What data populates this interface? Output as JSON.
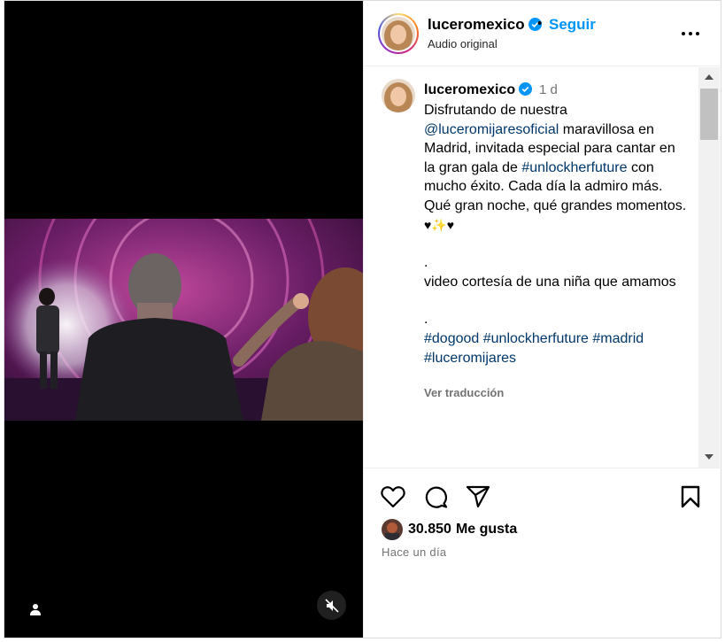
{
  "header": {
    "username": "luceromexico",
    "separator": "•",
    "follow_label": "Seguir",
    "audio_label": "Audio original",
    "more_icon": "more-options-icon"
  },
  "caption": {
    "username": "luceromexico",
    "time": "1 d",
    "line1_prefix": "Disfrutando de nuestra",
    "mention": "@luceromijaresoficial",
    "line1_suffix": " maravillosa en Madrid, invitada especial para cantar en la gran gala de ",
    "hashtag_inline": "#unlockherfuture",
    "line1_tail": " con mucho éxito. Cada día la admiro más. Qué gran noche, qué grandes momentos.",
    "dot1": ".",
    "line2": "video cortesía de una niña que amamos",
    "dot2": ".",
    "hashtags": [
      "#dogood",
      "#unlockherfuture",
      "#madrid",
      "#luceromijares"
    ],
    "translate_label": "Ver traducción"
  },
  "actions": {
    "like_icon": "heart-icon",
    "comment_icon": "comment-icon",
    "share_icon": "share-icon",
    "save_icon": "bookmark-icon",
    "likes_count": "30.850",
    "likes_label": "Me gusta",
    "posted": "Hace un día"
  },
  "media": {
    "user_tag_icon": "user-tag-icon",
    "mute_icon": "muted-speaker-icon"
  },
  "colors": {
    "link": "#00376b",
    "follow": "#0095f6",
    "verified": "#0095f6",
    "muted_text": "#737373"
  }
}
